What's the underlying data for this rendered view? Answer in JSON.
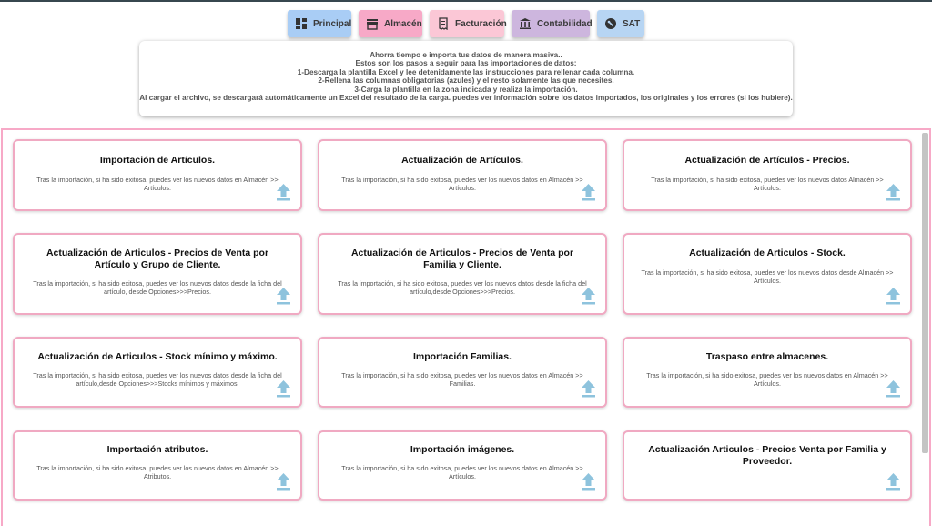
{
  "nav": {
    "buttons": [
      {
        "label": "Principal",
        "icon": "dashboard-icon",
        "color": "#a9cdf5"
      },
      {
        "label": "Almacén",
        "icon": "store-icon",
        "color": "#f7a9c7"
      },
      {
        "label": "Facturación",
        "icon": "receipt-icon",
        "color": "#fbc7d6"
      },
      {
        "label": "Contabilidad",
        "icon": "bank-icon",
        "color": "#cdb6de"
      },
      {
        "label": "SAT",
        "icon": "wrench-icon",
        "color": "#b7d5f3"
      }
    ]
  },
  "instructions": {
    "lines": [
      "Ahorra tiempo e importa tus datos de manera masiva..",
      "Estos son los pasos a seguir para las importaciones de datos:",
      "1-Descarga la plantilla Excel y lee detenidamente las instrucciones para rellenar cada columna.",
      "2-Rellena las columnas obligatorias (azules) y el resto solamente las que necesites.",
      "3-Carga la plantilla en la zona indicada y realiza la importación.",
      "Al cargar el archivo, se descargará automáticamente un Excel del resultado de la carga. puedes ver información sobre los datos importados, los originales y los errores (si los hubiere)."
    ]
  },
  "cards": [
    {
      "title": "Importación de Artículos.",
      "description": "Tras la importación, si ha sido exitosa, puedes ver los nuevos datos en Almacén >> Artículos."
    },
    {
      "title": "Actualización de Artículos.",
      "description": "Tras la importación, si ha sido exitosa, puedes ver los nuevos datos en Almacén >> Artículos."
    },
    {
      "title": "Actualización de Artículos - Precios.",
      "description": "Tras la importación, si ha sido exitosa, puedes ver los nuevos datos Almacén >> Artículos."
    },
    {
      "title": "Actualización de Articulos - Precios de Venta por Artículo y Grupo de Cliente.",
      "description": "Tras la importación, si ha sido exitosa, puedes ver los nuevos datos desde la ficha del artículo, desde Opciones>>>Precios."
    },
    {
      "title": "Actualización de Articulos - Precios de Venta por Familia y Cliente.",
      "description": "Tras la importación, si ha sido exitosa, puedes ver los nuevos datos desde la ficha del artículo,desde Opciones>>>Precios."
    },
    {
      "title": "Actualización de Articulos - Stock.",
      "description": "Tras la importación, si ha sido exitosa, puedes ver los nuevos datos desde Almacén >> Artículos."
    },
    {
      "title": "Actualización de Articulos - Stock mínimo y máximo.",
      "description": "Tras la importación, si ha sido exitosa, puedes ver los nuevos datos desde la ficha del artículo,desde Opciones>>>Stocks mínimos y máximos."
    },
    {
      "title": "Importación Familias.",
      "description": "Tras la importación, si ha sido exitosa, puedes ver los nuevos datos en Almacén >> Familias."
    },
    {
      "title": "Traspaso entre almacenes.",
      "description": "Tras la importación, si ha sido exitosa, puedes ver los nuevos datos en Almacén >> Artículos."
    },
    {
      "title": "Importación atributos.",
      "description": "Tras la importación, si ha sido exitosa, puedes ver los nuevos datos en Almacén >> Atributos."
    },
    {
      "title": "Importación imágenes.",
      "description": "Tras la importación, si ha sido exitosa, puedes ver los nuevos datos en Almacén >> Artículos."
    },
    {
      "title": "Actualización Articulos - Precios Venta por Familia y Proveedor.",
      "description": ""
    }
  ],
  "colors": {
    "card_border": "#f0a9c2",
    "panel_border": "#f7a9c7",
    "upload_icon": "#8ec3dd"
  }
}
